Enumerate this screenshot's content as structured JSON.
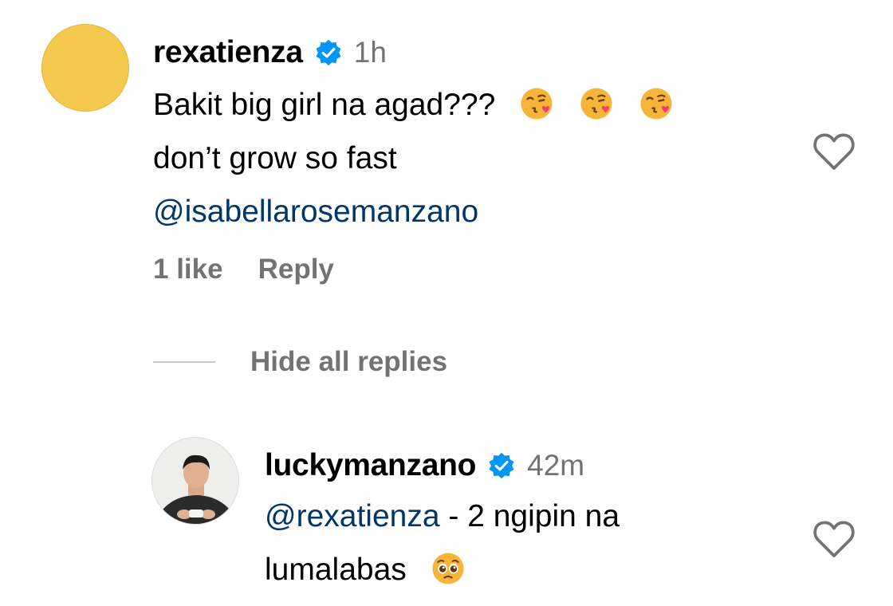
{
  "comment": {
    "username": "rexatienza",
    "timestamp": "1h",
    "text_line1": "Bakit big girl na agad???",
    "text_line2": "don’t grow so fast",
    "mention": "@isabellarosemanzano",
    "emojis": [
      "kissing-face-heart-icon",
      "kissing-face-heart-icon",
      "kissing-face-heart-icon"
    ],
    "likes": "1 like",
    "reply_label": "Reply",
    "avatar_color": "#f5c94d"
  },
  "replies_toggle": {
    "label": "Hide all replies"
  },
  "reply": {
    "username": "luckymanzano",
    "timestamp": "42m",
    "mention": "@rexatienza",
    "text_after_mention": " - 2 ngipin na",
    "text_line2": "lumalabas",
    "emoji": "pleading-face-icon"
  },
  "colors": {
    "verified_badge": "#0095f6",
    "link": "#00376b",
    "secondary_text": "#737373"
  }
}
